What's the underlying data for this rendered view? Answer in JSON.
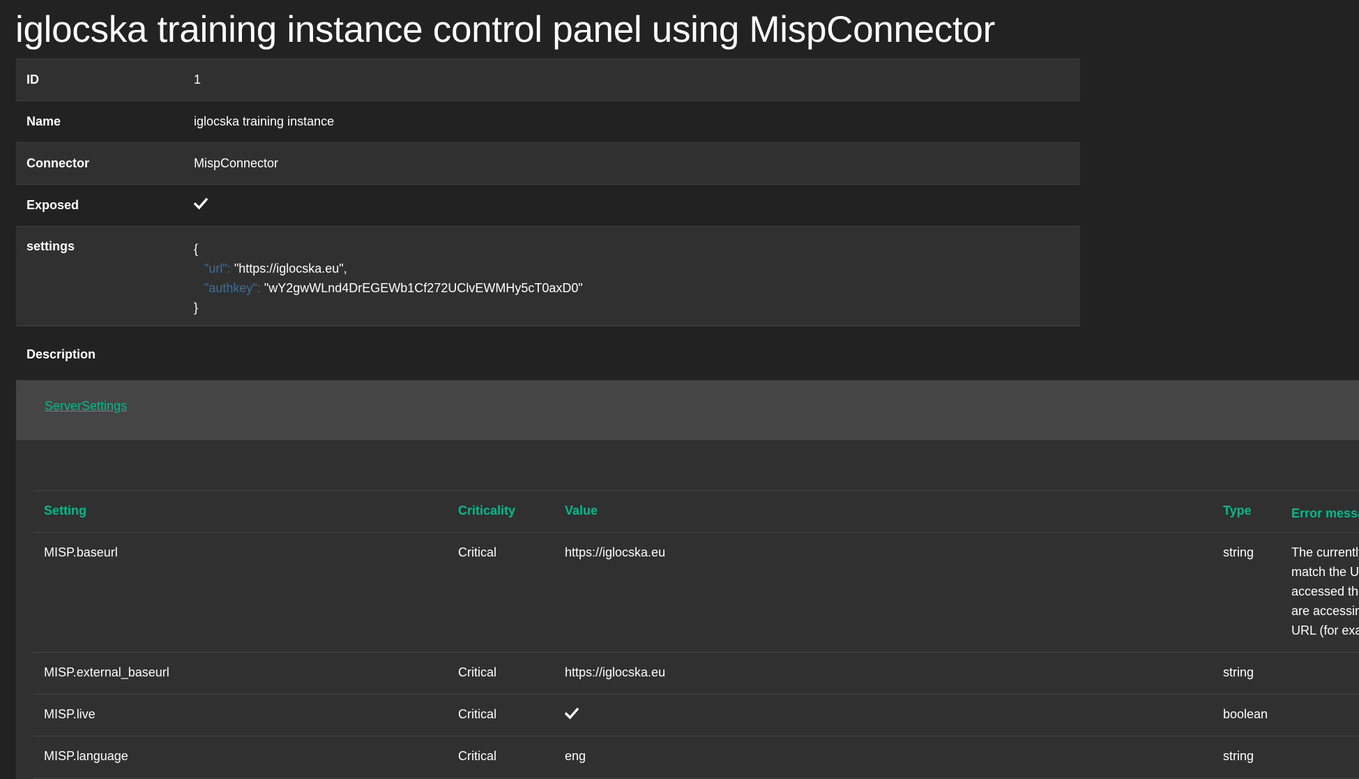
{
  "title": "iglocska training instance control panel using MispConnector",
  "details": {
    "id_label": "ID",
    "id_value": "1",
    "name_label": "Name",
    "name_value": "iglocska training instance",
    "connector_label": "Connector",
    "connector_value": "MispConnector",
    "exposed_label": "Exposed",
    "exposed_value": "check-icon",
    "settings_label": "settings",
    "settings_open": "{",
    "settings_url_key": "\"url\":",
    "settings_url_value": "\"https://iglocska.eu\",",
    "settings_authkey_key": "\"authkey\":",
    "settings_authkey_value": "\"wY2gwWLnd4DrEGEWb1Cf272UClvEWMHy5cT0axD0\"",
    "settings_close": "}",
    "description_label": "Description"
  },
  "server_settings": {
    "link_label": "ServerSettings",
    "columns": {
      "setting": "Setting",
      "criticality": "Criticality",
      "value": "Value",
      "type": "Type",
      "error": "Error message"
    },
    "rows": [
      {
        "setting": "MISP.baseurl",
        "criticality": "Critical",
        "value": "https://iglocska.eu",
        "type": "string",
        "error_lines": [
          "The currently s",
          "match the URL",
          "accessed the p",
          "are accessing t",
          "URL (for examp"
        ]
      },
      {
        "setting": "MISP.external_baseurl",
        "criticality": "Critical",
        "value": "https://iglocska.eu",
        "type": "string"
      },
      {
        "setting": "MISP.live",
        "criticality": "Critical",
        "value": "check-icon",
        "type": "boolean"
      },
      {
        "setting": "MISP.language",
        "criticality": "Critical",
        "value": "eng",
        "type": "string"
      }
    ]
  },
  "colors": {
    "background": "#222222",
    "stripe": "#303030",
    "panel_header": "#454545",
    "accent": "#00bc8c",
    "json_key": "#3c6d9c"
  }
}
